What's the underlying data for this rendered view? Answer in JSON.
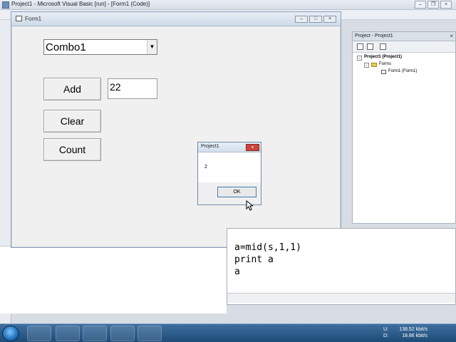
{
  "ide": {
    "title": "Project1 - Microsoft Visual Basic [run] - [Form1 (Code)]"
  },
  "form": {
    "title": "Form1",
    "combo_value": "Combo1",
    "add_label": "Add",
    "clear_label": "Clear",
    "count_label": "Count",
    "text_value": "22"
  },
  "msgbox": {
    "title": "Project1",
    "message": "2",
    "ok_label": "OK"
  },
  "project_explorer": {
    "title": "Project - Project1",
    "tree": [
      "Project1 (Project1)",
      "Forms",
      "Form1 (Form1)"
    ]
  },
  "code": {
    "lines": [
      "a=mid(s,1,1)",
      "print a",
      "a"
    ]
  },
  "taskbar": {
    "net_labels": [
      "U:",
      "D:"
    ],
    "net_values": [
      "138.52 kbit/s",
      "18.86 kbit/s"
    ]
  },
  "colors": {
    "accent": "#3c7fb1",
    "close_red": "#c9463d",
    "taskbar": "#1e4b78"
  }
}
